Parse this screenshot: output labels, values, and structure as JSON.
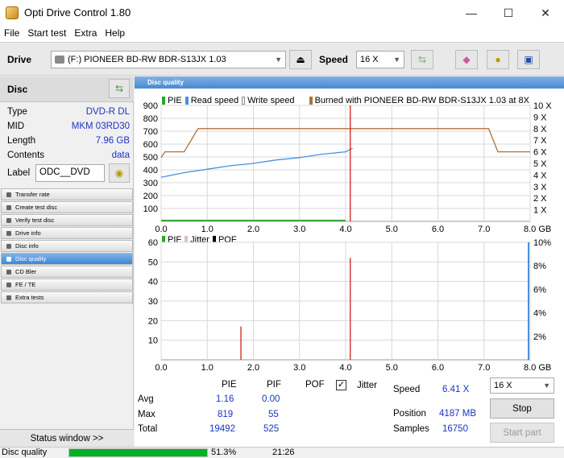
{
  "window": {
    "title": "Opti Drive Control 1.80",
    "minimize_glyph": "—",
    "maximize_glyph": "☐",
    "close_glyph": "✕"
  },
  "menu": [
    "File",
    "Start test",
    "Extra",
    "Help"
  ],
  "toolbar": {
    "drive_label": "Drive",
    "drive_value": "(F:)   PIONEER BD-RW   BDR-S13JX 1.03",
    "speed_label": "Speed",
    "speed_value": "16 X",
    "icons": [
      "eject-icon",
      "refresh-icon",
      "eraser-icon",
      "copy-icon",
      "save-icon"
    ]
  },
  "disc": {
    "title": "Disc",
    "rows": [
      {
        "k": "Type",
        "v": "DVD-R DL"
      },
      {
        "k": "MID",
        "v": "MKM 03RD30"
      },
      {
        "k": "Length",
        "v": "7.96 GB"
      },
      {
        "k": "Contents",
        "v": "data"
      }
    ],
    "label_key": "Label",
    "label_value": "ODC__DVD"
  },
  "nav": [
    {
      "label": "Transfer rate",
      "active": false
    },
    {
      "label": "Create test disc",
      "active": false
    },
    {
      "label": "Verify test disc",
      "active": false
    },
    {
      "label": "Drive info",
      "active": false
    },
    {
      "label": "Disc info",
      "active": false
    },
    {
      "label": "Disc quality",
      "active": true
    },
    {
      "label": "CD Bler",
      "active": false
    },
    {
      "label": "FE / TE",
      "active": false
    },
    {
      "label": "Extra tests",
      "active": false
    }
  ],
  "status_window_label": "Status window >>",
  "statusbar": {
    "label": "Disc quality",
    "progress_fraction": 1.0,
    "percent": "51.3%",
    "time": "21:26"
  },
  "panel_title": "Disc quality",
  "chart_data": [
    {
      "type": "line",
      "legend": [
        {
          "name": "PIE",
          "color": "#22aa22"
        },
        {
          "name": "Read speed",
          "color": "#4a8fe0"
        },
        {
          "name": "Write speed",
          "color": "#ffffff"
        },
        {
          "name": "Burned with PIONEER BD-RW  BDR-S13JX 1.03 at 8X",
          "color": "#b0703a"
        }
      ],
      "x_ticks": [
        "0.0",
        "1.0",
        "2.0",
        "3.0",
        "4.0",
        "5.0",
        "6.0",
        "7.0",
        "8.0 GB"
      ],
      "y_ticks_left": [
        "900",
        "800",
        "700",
        "600",
        "500",
        "400",
        "300",
        "200",
        "100"
      ],
      "y_ticks_right": [
        "10 X",
        "9 X",
        "8 X",
        "7 X",
        "6 X",
        "5 X",
        "4 X",
        "3 X",
        "2 X",
        "1 X"
      ],
      "xlim": [
        0,
        8
      ],
      "ylim": [
        0,
        900
      ],
      "y2lim": [
        0,
        10
      ],
      "series": [
        {
          "name": "Read speed",
          "x": [
            0.0,
            0.5,
            1.0,
            1.5,
            2.0,
            2.5,
            3.0,
            3.5,
            4.0,
            4.15
          ],
          "y": [
            3.8,
            4.2,
            4.5,
            4.8,
            5.0,
            5.3,
            5.5,
            5.8,
            6.0,
            6.3
          ]
        },
        {
          "name": "Write speed",
          "x": [
            0.0,
            0.08,
            0.2,
            0.4,
            0.5,
            0.8,
            1.0,
            4.0,
            4.1,
            7.1,
            7.3,
            8.0
          ],
          "y": [
            5.5,
            6.0,
            6.0,
            6.0,
            6.0,
            8.0,
            8.0,
            8.0,
            8.0,
            8.0,
            6.0,
            6.0
          ]
        },
        {
          "name": "PIE",
          "x": [
            0.0,
            1.0,
            2.0,
            3.0,
            4.0
          ],
          "y": [
            8,
            8,
            8,
            8,
            8
          ]
        }
      ],
      "spike": {
        "x": 4.1,
        "y": 900
      }
    },
    {
      "type": "bar",
      "legend": [
        {
          "name": "PIF",
          "color": "#22aa22"
        },
        {
          "name": "Jitter",
          "color": "#e3b8e0"
        },
        {
          "name": "POF",
          "color": "#000000"
        }
      ],
      "x_ticks": [
        "0.0",
        "1.0",
        "2.0",
        "3.0",
        "4.0",
        "5.0",
        "6.0",
        "7.0",
        "8.0 GB"
      ],
      "y_ticks_left": [
        "60",
        "50",
        "40",
        "30",
        "20",
        "10"
      ],
      "y_ticks_right": [
        "10%",
        "8%",
        "6%",
        "4%",
        "2%"
      ],
      "xlim": [
        0,
        8
      ],
      "ylim": [
        0,
        60
      ],
      "y2lim": [
        0,
        10
      ],
      "spikes": [
        {
          "x": 1.73,
          "y": 17
        },
        {
          "x": 4.1,
          "y": 52
        }
      ]
    }
  ],
  "stats": {
    "cols": [
      "PIE",
      "PIF",
      "POF"
    ],
    "jitter_label": "Jitter",
    "jitter_checked": "✓",
    "rows": [
      {
        "k": "Avg",
        "pie": "1.16",
        "pif": "0.00"
      },
      {
        "k": "Max",
        "pie": "819",
        "pif": "55"
      },
      {
        "k": "Total",
        "pie": "19492",
        "pif": "525"
      }
    ],
    "speed_label": "Speed",
    "speed_value": "6.41 X",
    "position_label": "Position",
    "position_value": "4187 MB",
    "samples_label": "Samples",
    "samples_value": "16750",
    "speed_select": "16 X",
    "stop_label": "Stop",
    "start_part_label": "Start part"
  }
}
